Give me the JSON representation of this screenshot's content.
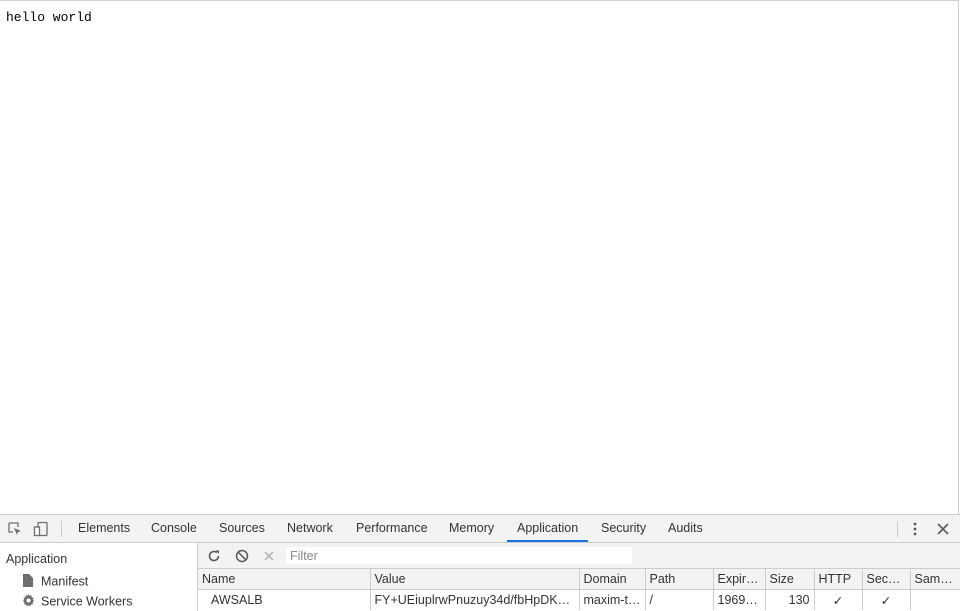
{
  "page": {
    "body_text": "hello world"
  },
  "devtools": {
    "toolbar": {
      "tabs": [
        {
          "label": "Elements"
        },
        {
          "label": "Console"
        },
        {
          "label": "Sources"
        },
        {
          "label": "Network"
        },
        {
          "label": "Performance"
        },
        {
          "label": "Memory"
        },
        {
          "label": "Application"
        },
        {
          "label": "Security"
        },
        {
          "label": "Audits"
        }
      ],
      "active_tab": "Application",
      "accent_color": "#1a73e8"
    },
    "sidebar": {
      "heading": "Application",
      "items": [
        {
          "label": "Manifest",
          "icon": "file-icon"
        },
        {
          "label": "Service Workers",
          "icon": "gear-icon"
        }
      ]
    },
    "filter": {
      "placeholder": "Filter",
      "value": ""
    },
    "cookies_table": {
      "columns": [
        "Name",
        "Value",
        "Domain",
        "Path",
        "Expir…",
        "Size",
        "HTTP",
        "Secure",
        "Sam…"
      ],
      "rows": [
        {
          "name": "AWSALB",
          "value": "FY+UEiuplrwPnuzuy34d/fbHpDKJ…",
          "domain": "maxim-t…",
          "path": "/",
          "expires": "1969…",
          "size": "130",
          "http": "✓",
          "secure": "✓",
          "samesite": ""
        }
      ]
    }
  }
}
